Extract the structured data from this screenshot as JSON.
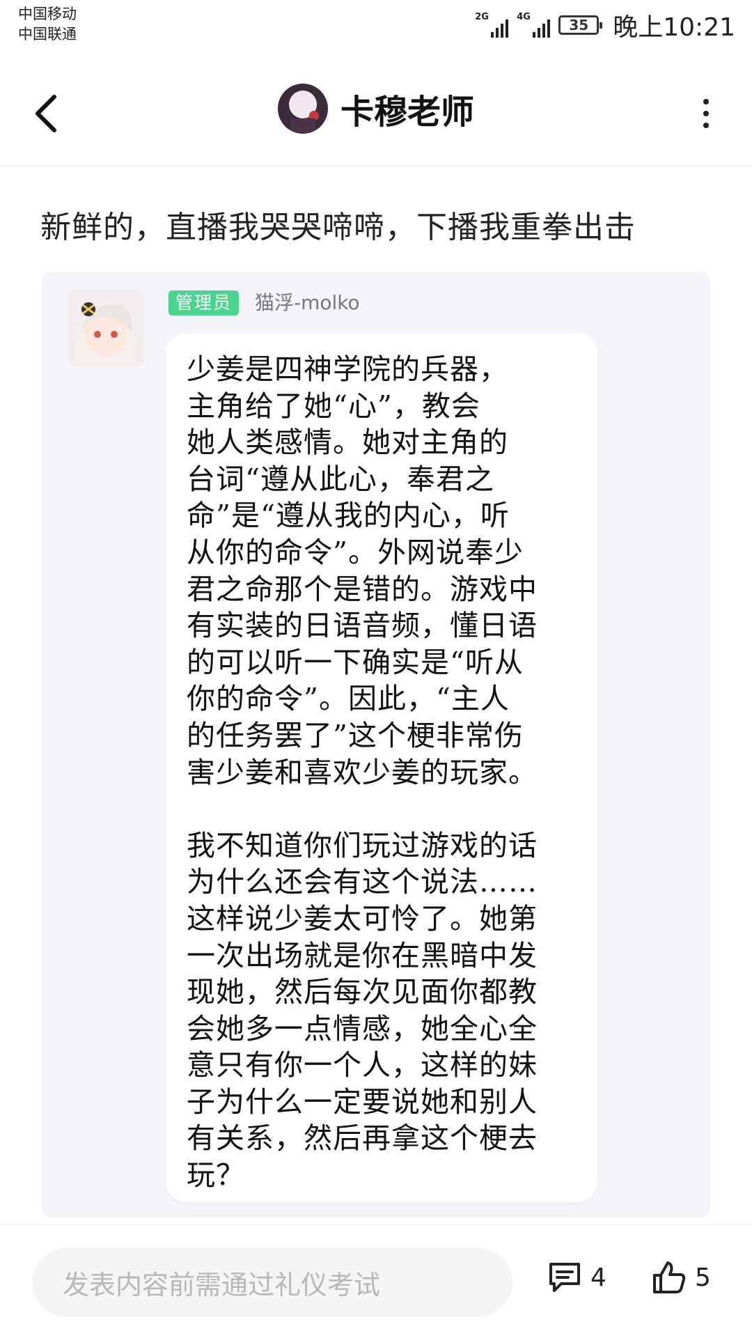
{
  "status_bar": {
    "carrier_1": "中国移动",
    "carrier_2": "中国联通",
    "network_1": "2G",
    "network_2": "4G",
    "battery": "35",
    "time": "晚上10:21"
  },
  "header": {
    "title": "卡穆老师",
    "back_icon": "chevron-left-icon",
    "more_icon": "more-vertical-icon"
  },
  "post": {
    "text": "新鲜的，直播我哭哭啼啼，下播我重拳出击"
  },
  "chat": {
    "badge": "管理员",
    "sender": "猫浮-molko",
    "paragraph_1": "少姜是四神学院的兵器，\n主角给了她“心”，教会\n她人类感情。她对主角的\n台词“遵从此心，奉君之\n命”是“遵从我的内心，听\n从你的命令”。外网说奉少\n君之命那个是错的。游戏中\n有实装的日语音频，懂日语\n的可以听一下确实是“听从\n你的命令”。因此，“主人\n的任务罢了”这个梗非常伤\n害少姜和喜欢少姜的玩家。",
    "paragraph_2": "我不知道你们玩过游戏的话\n为什么还会有这个说法……\n这样说少姜太可怜了。她第\n一次出场就是你在黑暗中发\n现她，然后每次见面你都教\n会她多一点情感，她全心全\n意只有你一个人，这样的妹\n子为什么一定要说她和别人\n有关系，然后再拿这个梗去\n玩？"
  },
  "footer": {
    "input_placeholder": "发表内容前需通过礼仪考试",
    "comment_count": "4",
    "like_count": "5",
    "comment_icon": "comment-icon",
    "like_icon": "thumbs-up-icon"
  },
  "colors": {
    "badge_green": "#4bd48e",
    "image_bg": "#f4f5fb",
    "input_bg": "#f5f5f5"
  }
}
